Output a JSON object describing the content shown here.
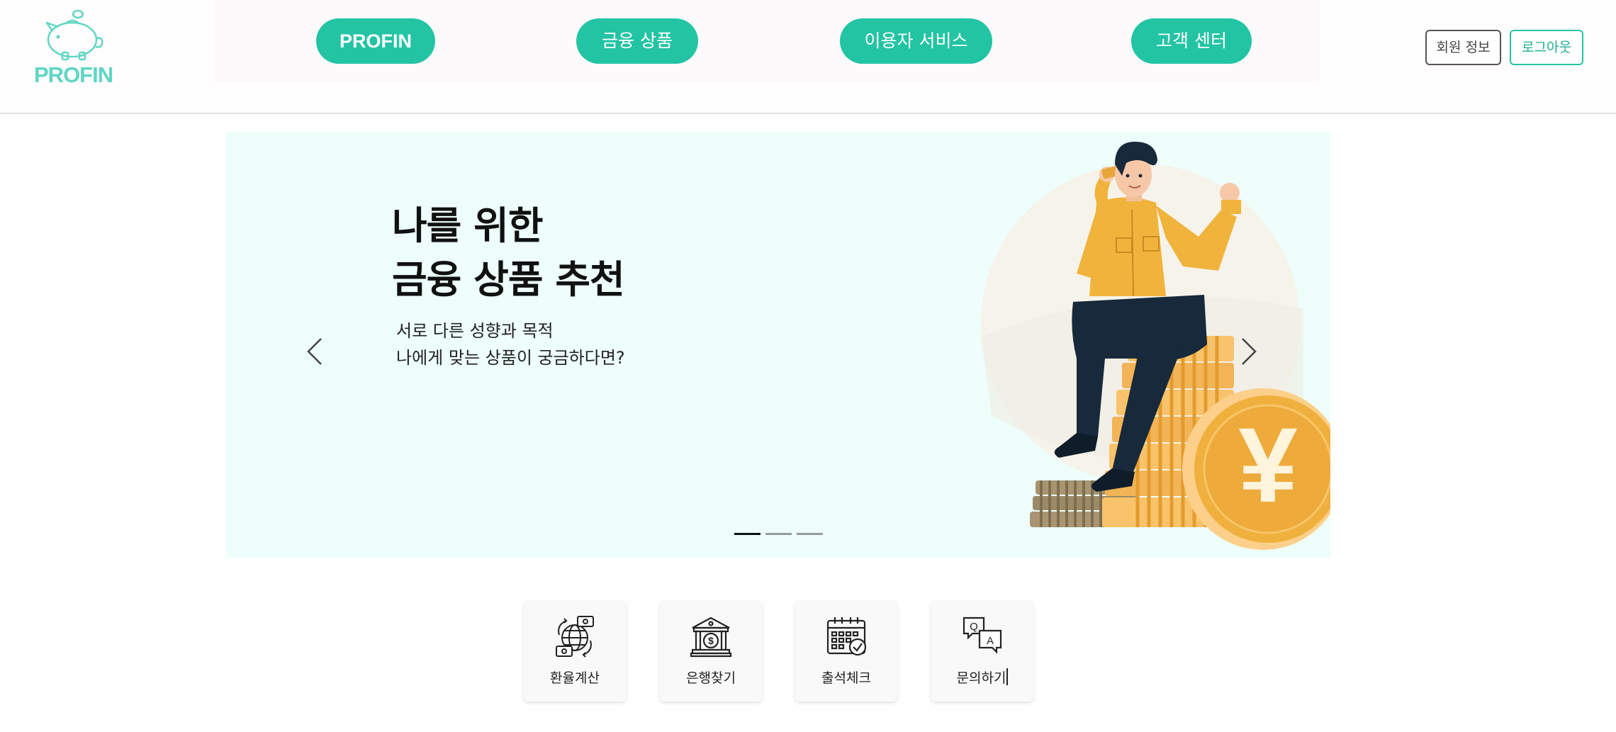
{
  "header": {
    "logo_text": "PROFIN",
    "nav": [
      {
        "label": "PROFIN"
      },
      {
        "label": "금융 상품"
      },
      {
        "label": "이용자 서비스"
      },
      {
        "label": "고객 센터"
      }
    ],
    "member_info_label": "회원 정보",
    "logout_label": "로그아웃"
  },
  "banner": {
    "title_line1": "나를 위한",
    "title_line2": "금융 상품 추천",
    "subtitle_line1": "서로 다른 성향과 목적",
    "subtitle_line2": "나에게 맞는 상품이 궁금하다면?",
    "slide_count": 3,
    "active_slide": 1,
    "currency_symbol": "¥"
  },
  "quick_menu": [
    {
      "label": "환율계산",
      "icon": "currency-exchange-icon"
    },
    {
      "label": "은행찾기",
      "icon": "bank-icon"
    },
    {
      "label": "출석체크",
      "icon": "calendar-check-icon"
    },
    {
      "label": "문의하기",
      "icon": "qna-chat-icon"
    }
  ],
  "colors": {
    "accent": "#23c4a4",
    "logo": "#5fd6c4",
    "banner_bg": "#edfefb",
    "shirt": "#f0b33c",
    "pants": "#17293a",
    "coin": "#f0b03e"
  }
}
